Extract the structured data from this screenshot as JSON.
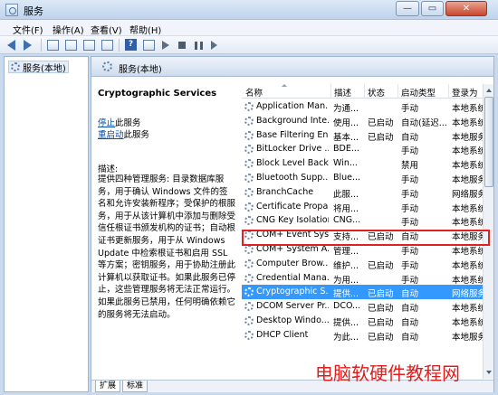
{
  "window": {
    "title": "服务"
  },
  "menu": [
    "文件(F)",
    "操作(A)",
    "查看(V)",
    "帮助(H)"
  ],
  "left_tree": {
    "label": "服务(本地)"
  },
  "header": {
    "title": "服务(本地)"
  },
  "description": {
    "service_name": "Cryptographic Services",
    "stop_link": "停止",
    "stop_suffix": "此服务",
    "restart_link": "重启动",
    "restart_suffix": "此服务",
    "label": "描述:",
    "text": "提供四种管理服务: 目录数据库服务，用于确认 Windows 文件的签名和允许安装新程序；受保护的根服务，用于从该计算机中添加与删除受信任根证书颁发机构的证书；自动根证书更新服务，用于从 Windows Update 中检索根证书和启用 SSL 等方案；密钥服务，用于协助注册此计算机以获取证书。如果此服务已停止，这些管理服务将无法正常运行。如果此服务已禁用，任何明确依赖它的服务将无法启动。"
  },
  "columns": [
    "名称",
    "描述",
    "状态",
    "启动类型",
    "登录为"
  ],
  "rows": [
    {
      "name": "Application Man...",
      "desc": "为通...",
      "status": "",
      "type": "手动",
      "logon": "本地系统"
    },
    {
      "name": "Background Inte...",
      "desc": "使用...",
      "status": "已启动",
      "type": "自动(延迟...",
      "logon": "本地系统"
    },
    {
      "name": "Base Filtering En...",
      "desc": "基本...",
      "status": "已启动",
      "type": "自动",
      "logon": "本地服务"
    },
    {
      "name": "BitLocker Drive ...",
      "desc": "BDE...",
      "status": "",
      "type": "手动",
      "logon": "本地系统"
    },
    {
      "name": "Block Level Back...",
      "desc": "Win...",
      "status": "",
      "type": "禁用",
      "logon": "本地系统"
    },
    {
      "name": "Bluetooth Supp...",
      "desc": "Blue...",
      "status": "",
      "type": "手动",
      "logon": "本地服务"
    },
    {
      "name": "BranchCache",
      "desc": "此服...",
      "status": "",
      "type": "手动",
      "logon": "网络服务"
    },
    {
      "name": "Certificate Propa...",
      "desc": "将用...",
      "status": "",
      "type": "手动",
      "logon": "本地系统"
    },
    {
      "name": "CNG Key Isolation",
      "desc": "CNG...",
      "status": "",
      "type": "手动",
      "logon": "本地系统"
    },
    {
      "name": "COM+ Event Sys...",
      "desc": "支持...",
      "status": "已启动",
      "type": "自动",
      "logon": "本地服务"
    },
    {
      "name": "COM+ System A...",
      "desc": "管理...",
      "status": "",
      "type": "手动",
      "logon": "本地系统"
    },
    {
      "name": "Computer Brow...",
      "desc": "维护...",
      "status": "已启动",
      "type": "手动",
      "logon": "本地系统"
    },
    {
      "name": "Credential Mana...",
      "desc": "为用...",
      "status": "",
      "type": "手动",
      "logon": "本地系统"
    },
    {
      "name": "Cryptographic S...",
      "desc": "提供...",
      "status": "已启动",
      "type": "自动",
      "logon": "网络服务"
    },
    {
      "name": "DCOM Server Pr...",
      "desc": "DCO...",
      "status": "已启动",
      "type": "自动",
      "logon": "本地系统"
    },
    {
      "name": "Desktop Windo...",
      "desc": "提供...",
      "status": "已启动",
      "type": "自动",
      "logon": "本地系统"
    },
    {
      "name": "DHCP Client",
      "desc": "为此...",
      "status": "已启动",
      "type": "自动",
      "logon": "本地服务"
    }
  ],
  "selected_row": 13,
  "tabs": [
    "扩展",
    "标准"
  ],
  "watermark": "电脑软硬件教程网",
  "colors": {
    "selection": "#3399ff",
    "highlight_border": "#e22020",
    "link": "#0b4ea6"
  }
}
